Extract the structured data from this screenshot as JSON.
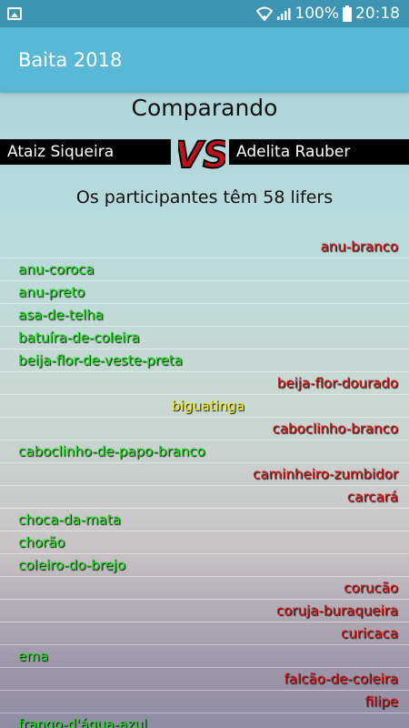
{
  "status_bar": {
    "battery": "100%",
    "time": "20:18",
    "icons": [
      "image-icon",
      "wifi-icon",
      "signal-icon",
      "battery-icon"
    ]
  },
  "app_bar": {
    "title": "Baita 2018"
  },
  "comparison": {
    "heading": "Comparando",
    "left_name": "Ataiz Siqueira",
    "right_name": "Adelita Rauber",
    "vs_label": "VS",
    "summary": "Os participantes têm 58 lifers"
  },
  "birds": [
    {
      "name": "anu-branco",
      "side": "right"
    },
    {
      "name": "anu-coroca",
      "side": "left"
    },
    {
      "name": "anu-preto",
      "side": "left"
    },
    {
      "name": "asa-de-telha",
      "side": "left"
    },
    {
      "name": "batuíra-de-coleira",
      "side": "left"
    },
    {
      "name": "beija-flor-de-veste-preta",
      "side": "left"
    },
    {
      "name": "beija-flor-dourado",
      "side": "right"
    },
    {
      "name": "biguatinga",
      "side": "both"
    },
    {
      "name": "caboclinho-branco",
      "side": "right"
    },
    {
      "name": "caboclinho-de-papo-branco",
      "side": "left"
    },
    {
      "name": "caminheiro-zumbidor",
      "side": "right"
    },
    {
      "name": "carcará",
      "side": "right"
    },
    {
      "name": "choca-da-mata",
      "side": "left"
    },
    {
      "name": "chorão",
      "side": "left"
    },
    {
      "name": "coleiro-do-brejo",
      "side": "left"
    },
    {
      "name": "corucão",
      "side": "right"
    },
    {
      "name": "coruja-buraqueira",
      "side": "right"
    },
    {
      "name": "curicaca",
      "side": "right"
    },
    {
      "name": "ema",
      "side": "left"
    },
    {
      "name": "falcão-de-coleira",
      "side": "right"
    },
    {
      "name": "filipe",
      "side": "right"
    },
    {
      "name": "frango-d'água-azul",
      "side": "left"
    }
  ],
  "colors": {
    "status_bar": "#3d95b3",
    "app_bar": "#58b8d5",
    "left_only": "#20e020",
    "right_only": "#dd1818",
    "both": "#f2ee20",
    "vs_red": "#c0121a"
  }
}
